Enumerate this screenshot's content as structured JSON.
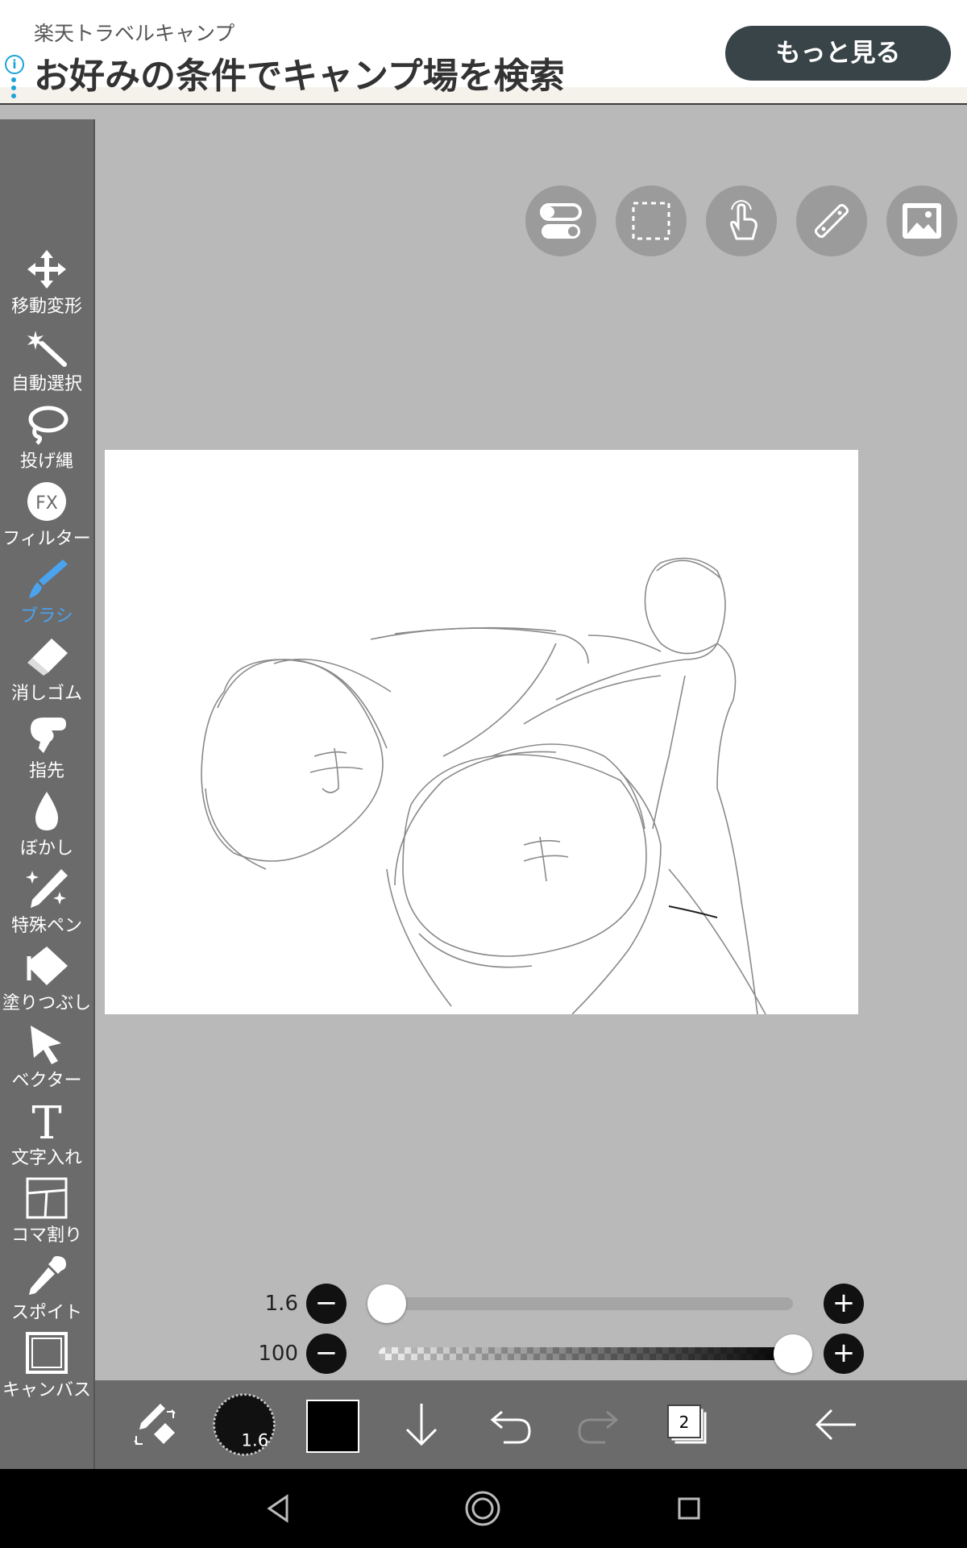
{
  "ad": {
    "subtitle": "楽天トラベルキャンプ",
    "title": "お好みの条件でキャンプ場を検索",
    "button": "もっと見る",
    "info_icon": "i"
  },
  "tools": [
    {
      "id": "move",
      "label": "移動変形",
      "icon": "move-icon"
    },
    {
      "id": "auto-select",
      "label": "自動選択",
      "icon": "magic-wand-icon"
    },
    {
      "id": "lasso",
      "label": "投げ縄",
      "icon": "lasso-icon"
    },
    {
      "id": "filter",
      "label": "フィルター",
      "icon": "fx-icon",
      "icon_text": "FX"
    },
    {
      "id": "brush",
      "label": "ブラシ",
      "icon": "brush-icon",
      "active": true
    },
    {
      "id": "eraser",
      "label": "消しゴム",
      "icon": "eraser-icon"
    },
    {
      "id": "finger",
      "label": "指先",
      "icon": "finger-icon"
    },
    {
      "id": "blur",
      "label": "ぼかし",
      "icon": "drop-icon"
    },
    {
      "id": "special-pen",
      "label": "特殊ペン",
      "icon": "sparkle-pen-icon"
    },
    {
      "id": "fill",
      "label": "塗りつぶし",
      "icon": "fill-icon"
    },
    {
      "id": "vector",
      "label": "ベクター",
      "icon": "cursor-icon"
    },
    {
      "id": "text",
      "label": "文字入れ",
      "icon": "text-icon",
      "icon_text": "T"
    },
    {
      "id": "panel",
      "label": "コマ割り",
      "icon": "panel-icon"
    },
    {
      "id": "eyedropper",
      "label": "スポイト",
      "icon": "eyedropper-icon"
    },
    {
      "id": "canvas",
      "label": "キャンバス",
      "icon": "canvas-icon"
    }
  ],
  "top_buttons": [
    "toggle-icon",
    "selection-icon",
    "gesture-icon",
    "ruler-icon",
    "image-icon"
  ],
  "sliders": {
    "size": {
      "value_label": "1.6",
      "value": 1.6,
      "fraction": 0.02
    },
    "opacity": {
      "value_label": "100",
      "value": 100,
      "fraction": 1.0
    },
    "minus": "−",
    "plus": "+"
  },
  "bottom_bar": {
    "brush_size_label": "1.6",
    "color": "#000000",
    "layer_count": "2"
  },
  "colors": {
    "accent": "#4aa3ef",
    "toolbar": "#6b6b6b",
    "background": "#b9b9b9"
  }
}
